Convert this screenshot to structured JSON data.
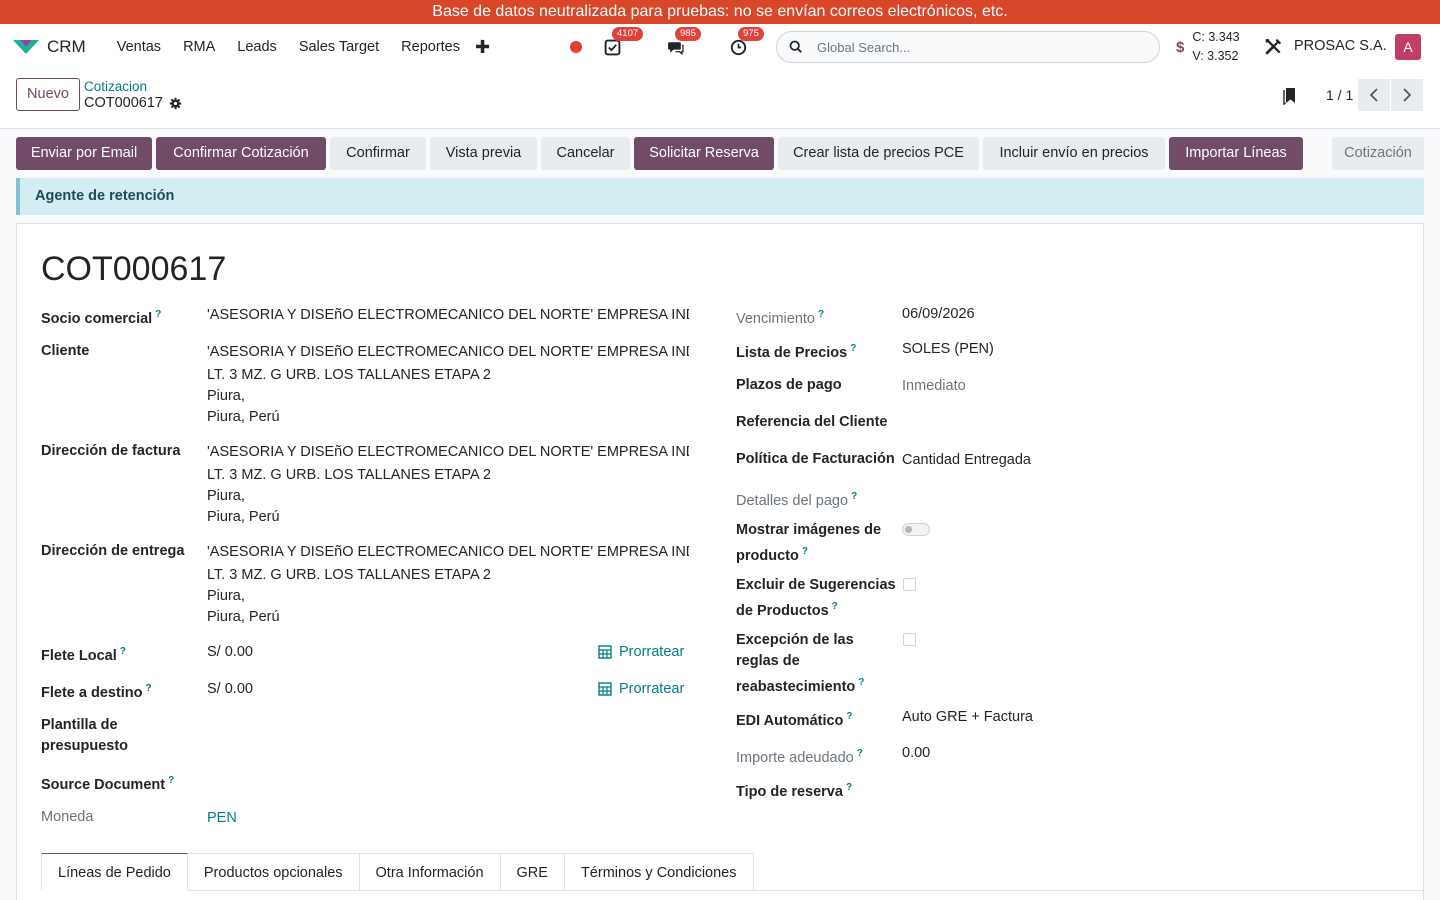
{
  "banner": "Base de datos neutralizada para pruebas: no se envían correos electrónicos, etc.",
  "navbar": {
    "app_name": "CRM",
    "menu": [
      "Ventas",
      "RMA",
      "Leads",
      "Sales Target",
      "Reportes"
    ],
    "activity_count": "4107",
    "message_count": "985",
    "timer_count": "975",
    "search_placeholder": "Global Search...",
    "rate_buy": "C: 3.343",
    "rate_sell": "V: 3.352",
    "currency_symbol": "$",
    "company": "PROSAC S.A.",
    "avatar_letter": "A"
  },
  "control": {
    "new_label": "Nuevo",
    "breadcrumb_parent": "Cotizacion",
    "breadcrumb_current": "COT000617",
    "pager": "1 / 1"
  },
  "actions": {
    "send_email": "Enviar por Email",
    "confirm_quote": "Confirmar Cotización",
    "confirm": "Confirmar",
    "preview": "Vista previa",
    "cancel": "Cancelar",
    "request_reservation": "Solicitar Reserva",
    "create_pricelist": "Crear lista de precios PCE",
    "include_shipping": "Incluir envío en precios",
    "import_lines": "Importar Líneas",
    "stage": "Cotización"
  },
  "alert": "Agente de retención",
  "form": {
    "title": "COT000617",
    "help_mark": "?",
    "left": {
      "partner_label": "Socio comercial",
      "partner_value": "'ASESORIA Y DISEñO ELECTROMECANICO DEL NORTE' EMPRESA INDIVID",
      "client_label": "Cliente",
      "client_lines": [
        "'ASESORIA Y DISEñO ELECTROMECANICO DEL NORTE' EMPRESA IND",
        "LT. 3 MZ. G URB. LOS TALLANES ETAPA 2",
        "Piura,",
        "Piura, Perú"
      ],
      "invoice_label": "Dirección de factura",
      "invoice_lines": [
        "'ASESORIA Y DISEñO ELECTROMECANICO DEL NORTE' EMPRESA IND",
        "LT. 3 MZ. G URB. LOS TALLANES ETAPA 2",
        "Piura,",
        "Piura, Perú"
      ],
      "delivery_label": "Dirección de entrega",
      "delivery_lines": [
        "'ASESORIA Y DISEñO ELECTROMECANICO DEL NORTE' EMPRESA IND",
        "LT. 3 MZ. G URB. LOS TALLANES ETAPA 2",
        "Piura,",
        "Piura, Perú"
      ],
      "local_freight_label": "Flete Local",
      "local_freight_value": "S/ 0.00",
      "dest_freight_label": "Flete a destino",
      "dest_freight_value": "S/ 0.00",
      "prorate_label": "Prorratear",
      "template_label_1": "Plantilla de",
      "template_label_2": "presupuesto",
      "source_label": "Source Document",
      "currency_label": "Moneda",
      "currency_value": "PEN"
    },
    "right": {
      "expiry_label": "Vencimiento",
      "expiry_value": "06/09/2026",
      "pricelist_label": "Lista de Precios",
      "pricelist_value": "SOLES (PEN)",
      "terms_label": "Plazos de pago",
      "terms_value": "Inmediato",
      "customer_ref_label": "Referencia del Cliente",
      "invoice_policy_label": "Política de Facturación",
      "invoice_policy_value": "Cantidad Entregada",
      "payment_details_label": "Detalles del pago",
      "show_images_label_1": "Mostrar imágenes de",
      "show_images_label_2": "producto",
      "exclude_suggestions_label_1": "Excluir de Sugerencias",
      "exclude_suggestions_label_2": "de Productos",
      "replenish_label_1": "Excepción de las",
      "replenish_label_2": "reglas de",
      "replenish_label_3": "reabastecimiento",
      "edi_label": "EDI Automático",
      "edi_value": "Auto GRE + Factura",
      "amount_due_label": "Importe adeudado",
      "amount_due_value": "0.00",
      "reservation_type_label": "Tipo de reserva"
    },
    "tabs": [
      "Líneas de Pedido",
      "Productos opcionales",
      "Otra Información",
      "GRE",
      "Términos y Condiciones"
    ]
  }
}
